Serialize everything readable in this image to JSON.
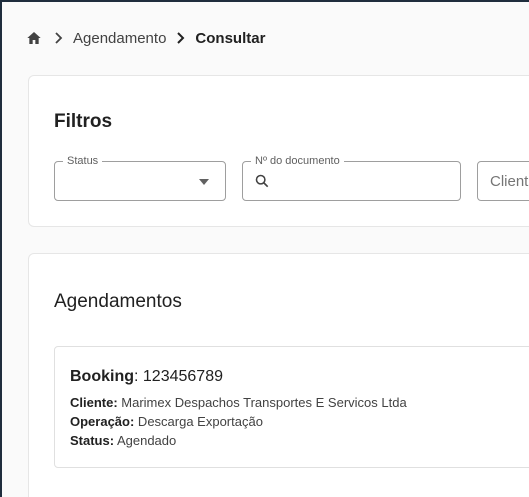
{
  "breadcrumb": {
    "items": [
      "Agendamento",
      "Consultar"
    ]
  },
  "filters": {
    "title": "Filtros",
    "status": {
      "label": "Status",
      "value": ""
    },
    "documento": {
      "label": "Nº do documento",
      "value": ""
    },
    "cliente": {
      "placeholder": "Client"
    }
  },
  "agendamentos": {
    "title": "Agendamentos",
    "items": [
      {
        "booking_label": "Booking",
        "booking_value": " 123456789",
        "cliente_label": "Cliente:",
        "cliente_value": " Marimex Despachos Transportes E Servicos Ltda",
        "operacao_label": "Operação:",
        "operacao_value": " Descarga Exportação",
        "status_label": "Status:",
        "status_value": " Agendado"
      }
    ]
  },
  "colors": {
    "frame_border": "#1f2d3d",
    "background": "#fafafa",
    "card": "#ffffff",
    "field_border": "#9e9e9e"
  },
  "icons": [
    "home-icon",
    "chevron-right-icon",
    "caret-down-icon",
    "search-icon"
  ]
}
